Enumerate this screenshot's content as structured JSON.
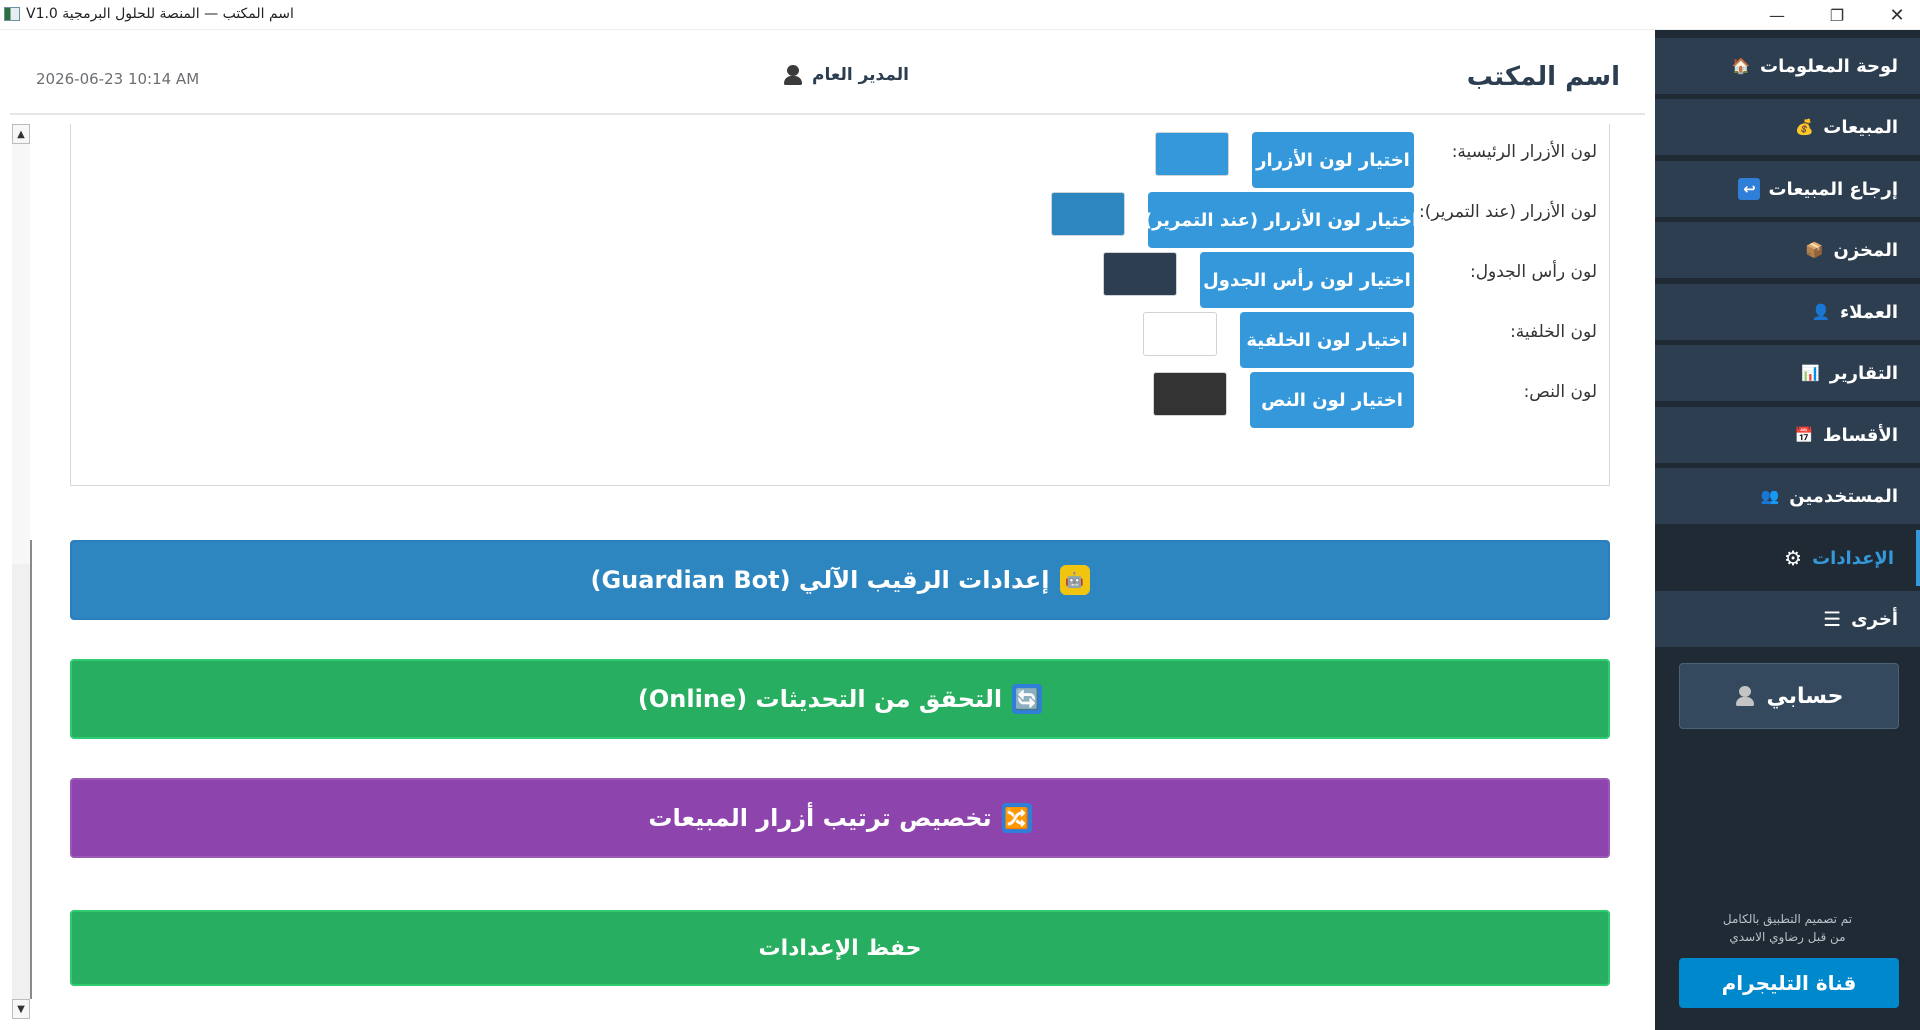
{
  "window": {
    "title": "V1.0 اسم المكتب — المنصة للحلول البرمجية",
    "min_glyph": "—",
    "max_glyph": "❐",
    "close_glyph": "✕"
  },
  "header": {
    "office_name": "اسم المكتب",
    "user_name": "المدير العام",
    "datetime": "2026-06-23  10:14 AM"
  },
  "colors": {
    "rows": [
      {
        "label": "لون الأزرار الرئيسية:",
        "button": "اختيار لون الأزرار",
        "swatch": "#3498db"
      },
      {
        "label": "لون الأزرار (عند التمرير):",
        "button": "اختيار لون الأزرار (عند التمرير)",
        "swatch": "#2e86c1"
      },
      {
        "label": "لون رأس الجدول:",
        "button": "اختيار لون رأس الجدول",
        "swatch": "#2c3e50"
      },
      {
        "label": "لون الخلفية:",
        "button": "اختيار لون الخلفية",
        "swatch": "#ffffff"
      },
      {
        "label": "لون النص:",
        "button": "اختيار لون النص",
        "swatch": "#333333"
      }
    ]
  },
  "actions": {
    "guardian": "إعدادات الرقيب الآلي (Guardian Bot)",
    "update": "التحقق من التحديثات (Online)",
    "reorder": "تخصيص ترتيب أزرار المبيعات",
    "save": "حفظ الإعدادات",
    "guardian_icon": "robot-icon",
    "update_icon": "refresh-icon",
    "reorder_icon": "shuffle-icon"
  },
  "sidebar": {
    "items": [
      {
        "label": "لوحة المعلومات",
        "icon": "house-icon",
        "glyph": "🏠"
      },
      {
        "label": "المبيعات",
        "icon": "money-bag-icon",
        "glyph": "💰"
      },
      {
        "label": "إرجاع المبيعات",
        "icon": "return-arrow-icon",
        "glyph": "↩"
      },
      {
        "label": "المخزن",
        "icon": "package-icon",
        "glyph": "📦"
      },
      {
        "label": "العملاء",
        "icon": "user-icon",
        "glyph": "👤"
      },
      {
        "label": "التقارير",
        "icon": "bar-chart-icon",
        "glyph": "📊"
      },
      {
        "label": "الأقساط",
        "icon": "calendar-icon",
        "glyph": "📅"
      },
      {
        "label": "المستخدمين",
        "icon": "users-icon",
        "glyph": "👥"
      },
      {
        "label": "الإعدادات",
        "icon": "gear-icon",
        "glyph": "⚙",
        "active": true
      },
      {
        "label": "أخرى",
        "icon": "menu-icon",
        "glyph": "☰"
      }
    ],
    "account": "حسابي",
    "credit_line1": "تم تصميم التطبيق بالكامل",
    "credit_line2": "من قبل رضاوي الاسدي",
    "telegram": "قناة التليجرام"
  },
  "palette": {
    "accent": "#3498db",
    "sidebar_bg": "#2c3e50",
    "success": "#27ae60",
    "purple": "#8e44ad",
    "telegram": "#0088cc"
  }
}
